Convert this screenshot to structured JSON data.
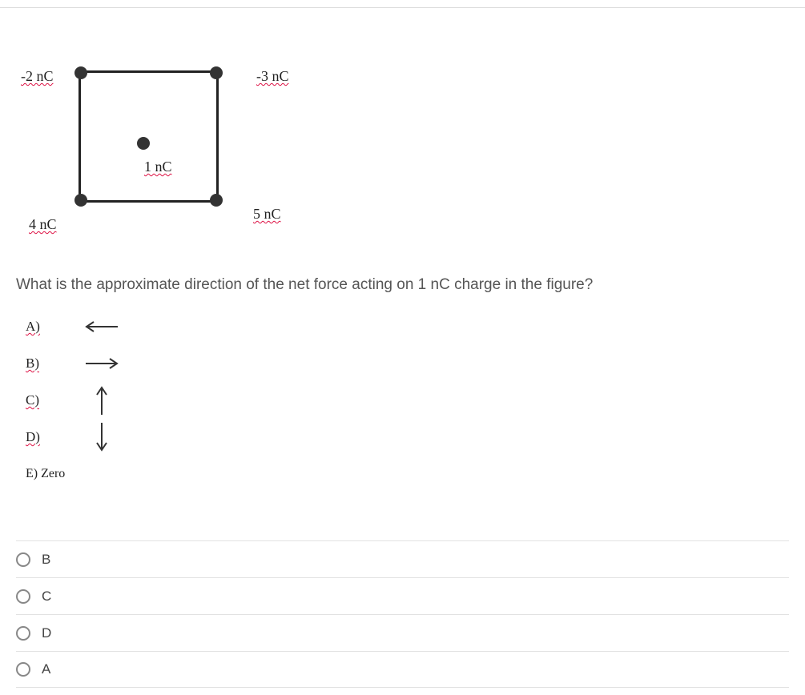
{
  "diagram": {
    "charges": {
      "top_left": "-2 nC",
      "top_right": "-3 nC",
      "bottom_left": "4 nC",
      "bottom_right": "5 nC",
      "center": "1 nC"
    }
  },
  "question": "What is the approximate direction of the net force acting on 1 nC charge in the figure?",
  "answer_key": {
    "A": "A)",
    "B": "B)",
    "C": "C)",
    "D": "D)",
    "E": "E) Zero"
  },
  "arrows": {
    "A": "left",
    "B": "right",
    "C": "up",
    "D": "down"
  },
  "options": [
    "B",
    "C",
    "D",
    "A"
  ],
  "chart_data": {
    "type": "diagram",
    "description": "Square with point charges at corners and one in center",
    "points": [
      {
        "position": "top-left",
        "charge_nC": -2
      },
      {
        "position": "top-right",
        "charge_nC": -3
      },
      {
        "position": "bottom-left",
        "charge_nC": 4
      },
      {
        "position": "bottom-right",
        "charge_nC": 5
      },
      {
        "position": "center",
        "charge_nC": 1
      }
    ]
  }
}
